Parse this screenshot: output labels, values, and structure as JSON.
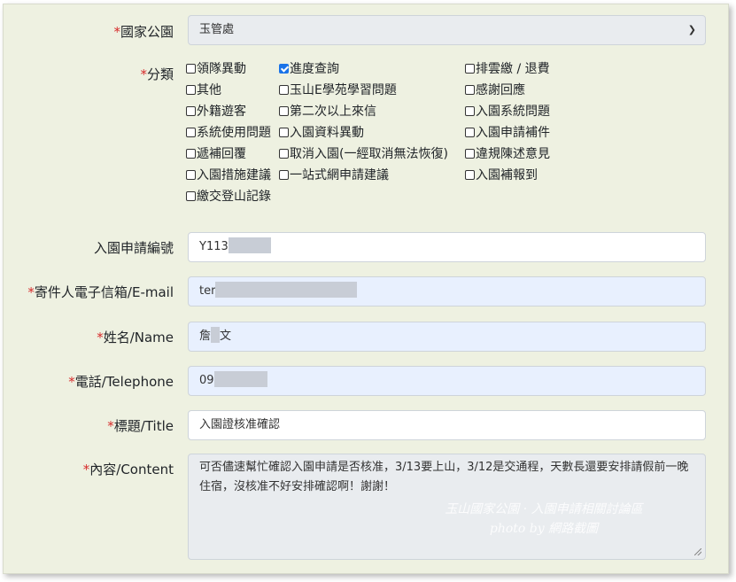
{
  "form": {
    "park": {
      "req": "*",
      "label": "國家公園",
      "value": "玉管處"
    },
    "category": {
      "req": "*",
      "label": "分類",
      "options": [
        {
          "label": "領隊異動",
          "checked": false
        },
        {
          "label": "進度查詢",
          "checked": true
        },
        {
          "label": "排雲繳 / 退費",
          "checked": false
        },
        {
          "label": "其他",
          "checked": false
        },
        {
          "label": "玉山E學苑學習問題",
          "checked": false
        },
        {
          "label": "感謝回應",
          "checked": false
        },
        {
          "label": "外籍遊客",
          "checked": false
        },
        {
          "label": "第二次以上來信",
          "checked": false
        },
        {
          "label": "入園系統問題",
          "checked": false
        },
        {
          "label": "系統使用問題",
          "checked": false
        },
        {
          "label": "入園資料異動",
          "checked": false
        },
        {
          "label": "入園申請補件",
          "checked": false
        },
        {
          "label": "遞補回覆",
          "checked": false
        },
        {
          "label": "取消入園(一經取消無法恢復)",
          "checked": false
        },
        {
          "label": "違規陳述意見",
          "checked": false
        },
        {
          "label": "入園措施建議",
          "checked": false
        },
        {
          "label": "一站式網申請建議",
          "checked": false
        },
        {
          "label": "入園補報到",
          "checked": false
        },
        {
          "label": "繳交登山記錄",
          "checked": false
        }
      ]
    },
    "app_no": {
      "label": "入園申請編號",
      "value": "Y113"
    },
    "email": {
      "req": "*",
      "label": "寄件人電子信箱/E-mail",
      "value": "ter"
    },
    "name": {
      "req": "*",
      "label": "姓名/Name",
      "value_a": "詹",
      "value_b": "文"
    },
    "phone": {
      "req": "*",
      "label": "電話/Telephone",
      "value": "09"
    },
    "title": {
      "req": "*",
      "label": "標題/Title",
      "value": "入園證核准確認"
    },
    "content": {
      "req": "*",
      "label": "內容/Content",
      "value": "可否儘速幫忙確認入園申請是否核准，3/13要上山，3/12是交通程，天數長還要安排請假前一晚住宿，沒核准不好安排確認啊！謝謝！"
    }
  },
  "watermark": {
    "line1": "玉山國家公園 · 入園申請相關討論區",
    "line2": "photo by 網路截圖"
  }
}
